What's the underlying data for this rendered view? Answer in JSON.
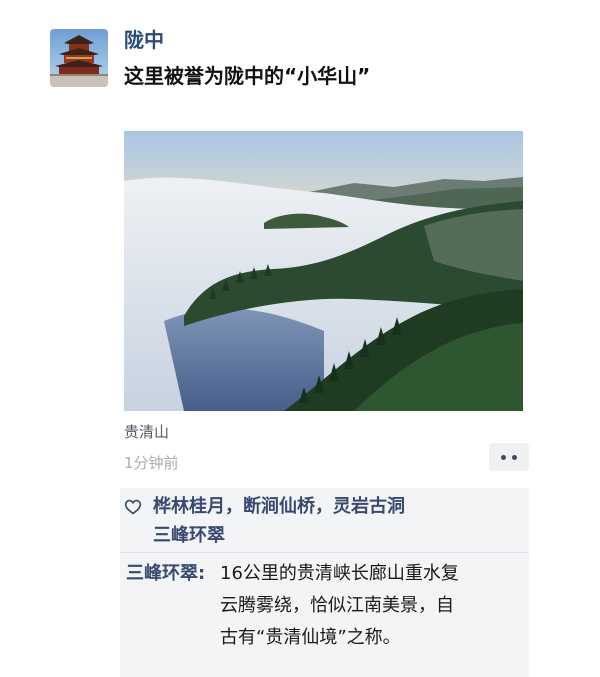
{
  "post": {
    "author": "陇中",
    "text": "这里被誉为陇中的“小华山”",
    "photo_caption_location": "贵清山",
    "timestamp": "1分钟前"
  },
  "likes": {
    "icon": "heart-icon",
    "line1": "桦林桂月，断涧仙桥，灵岩古洞",
    "line2": "三峰环翠"
  },
  "comment": {
    "author": "三峰环翠:",
    "lines": [
      "16公里的贵清峡长廊山重水复",
      "云腾雾绕，恰似江南美景，自",
      "古有“贵清仙境”之称。"
    ]
  },
  "colors": {
    "name_link": "#394a70",
    "panel_bg": "#f3f4f6",
    "timestamp": "#a8adb5"
  }
}
